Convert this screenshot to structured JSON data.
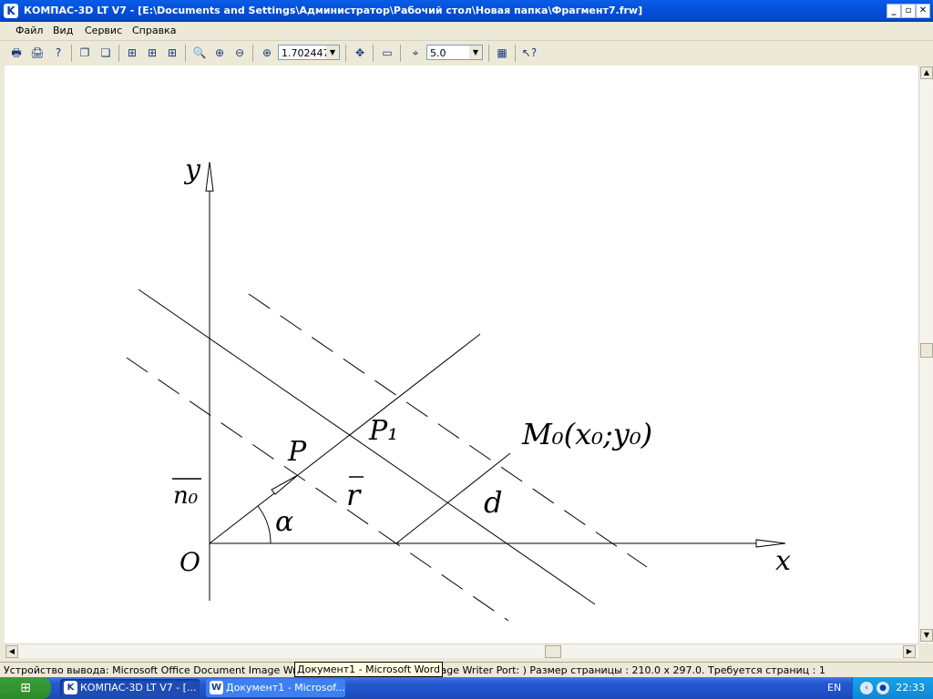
{
  "window": {
    "title": "КОМПАС-3D LT V7 - [E:\\Documents and Settings\\Администратор\\Рабочий стол\\Новая папка\\Фрагмент7.frw]",
    "app_icon_letter": "K",
    "buttons": [
      "_",
      "▫",
      "✕"
    ]
  },
  "menu": {
    "items": [
      {
        "label": "Файл"
      },
      {
        "label": "Вид"
      },
      {
        "label": "Сервис"
      },
      {
        "label": "Справка"
      }
    ]
  },
  "toolbar": {
    "zoom_value": "1.702447",
    "step_value": "5.0"
  },
  "drawing": {
    "labels": {
      "y_axis": "y",
      "x_axis": "x",
      "origin": "O",
      "normal": "n₀",
      "point_p": "P",
      "point_p1": "P₁",
      "point_m0": "M₀(x₀;y₀)",
      "radius": "r",
      "distance": "d",
      "angle": "α"
    }
  },
  "status": {
    "text": "Устройство вывода: Microsoft Office Document Image Writer ( Microsoft Document Image Writer Port: )  Размер страницы : 210.0 x 297.0.  Требуется страниц : 1",
    "tooltip": "Документ1 - Microsoft Word"
  },
  "taskbar": {
    "tasks": [
      {
        "label": "КОМПАС-3D LT V7 - [...",
        "icon": "K"
      },
      {
        "label": "Документ1 - Microsof...",
        "icon": "W"
      }
    ],
    "language": "EN",
    "clock": "22:33"
  }
}
